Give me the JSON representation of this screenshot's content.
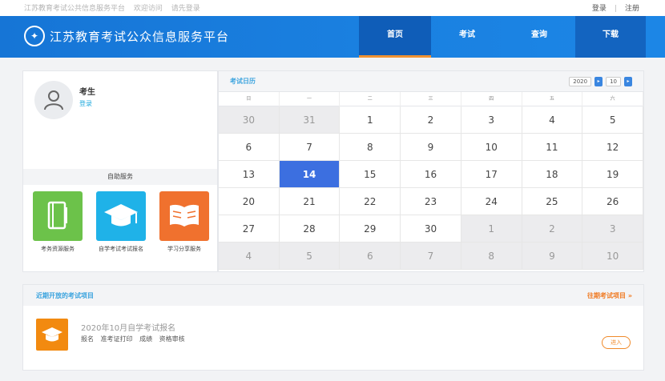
{
  "topbar": {
    "welcome": [
      "江苏教育考试公共信息服务平台",
      "欢迎访问",
      "请先登录"
    ],
    "login": "登录",
    "register": "注册"
  },
  "header": {
    "site_title": "江苏教育考试公众信息服务平台",
    "nav": [
      {
        "label": "首页",
        "active": true
      },
      {
        "label": "考试",
        "active": false
      },
      {
        "label": "查询",
        "active": false
      },
      {
        "label": "下载",
        "active": false
      }
    ]
  },
  "profile": {
    "name": "考生",
    "link": "登录",
    "services_title": "自助服务",
    "services": [
      {
        "label": "考务资源服务",
        "color": "#6cc24a",
        "icon": "document-icon"
      },
      {
        "label": "自学考试考试报名",
        "color": "#1fb2e8",
        "icon": "graduation-cap-icon"
      },
      {
        "label": "学习分享服务",
        "color": "#f0712e",
        "icon": "book-icon"
      }
    ]
  },
  "calendar": {
    "title": "考试日历",
    "controls": {
      "year": "2020",
      "month": "10"
    },
    "weekdays": [
      "日",
      "一",
      "二",
      "三",
      "四",
      "五",
      "六"
    ],
    "days": [
      {
        "d": "30",
        "m": true
      },
      {
        "d": "31",
        "m": true
      },
      {
        "d": "1"
      },
      {
        "d": "2"
      },
      {
        "d": "3"
      },
      {
        "d": "4"
      },
      {
        "d": "5"
      },
      {
        "d": "6"
      },
      {
        "d": "7"
      },
      {
        "d": "8"
      },
      {
        "d": "9"
      },
      {
        "d": "10"
      },
      {
        "d": "11"
      },
      {
        "d": "12"
      },
      {
        "d": "13"
      },
      {
        "d": "14",
        "today": true
      },
      {
        "d": "15"
      },
      {
        "d": "16"
      },
      {
        "d": "17"
      },
      {
        "d": "18"
      },
      {
        "d": "19"
      },
      {
        "d": "20"
      },
      {
        "d": "21"
      },
      {
        "d": "22"
      },
      {
        "d": "23"
      },
      {
        "d": "24"
      },
      {
        "d": "25"
      },
      {
        "d": "26"
      },
      {
        "d": "27"
      },
      {
        "d": "28"
      },
      {
        "d": "29"
      },
      {
        "d": "30"
      },
      {
        "d": "1",
        "m": true
      },
      {
        "d": "2",
        "m": true
      },
      {
        "d": "3",
        "m": true
      },
      {
        "d": "4",
        "m": true
      },
      {
        "d": "5",
        "m": true
      },
      {
        "d": "6",
        "m": true
      },
      {
        "d": "7",
        "m": true
      },
      {
        "d": "8",
        "m": true
      },
      {
        "d": "9",
        "m": true
      },
      {
        "d": "10",
        "m": true
      }
    ]
  },
  "exams": {
    "title": "近期开放的考试项目",
    "more": "往期考试项目 »",
    "item": {
      "name": "2020年10月自学考试报名",
      "tags": [
        "报名",
        "准考证打印",
        "成绩",
        "资格审核"
      ],
      "enter": "进入"
    }
  },
  "colors": {
    "brand": "#1a80e0",
    "accent": "#f08a2a",
    "today": "#3c6fe0"
  }
}
